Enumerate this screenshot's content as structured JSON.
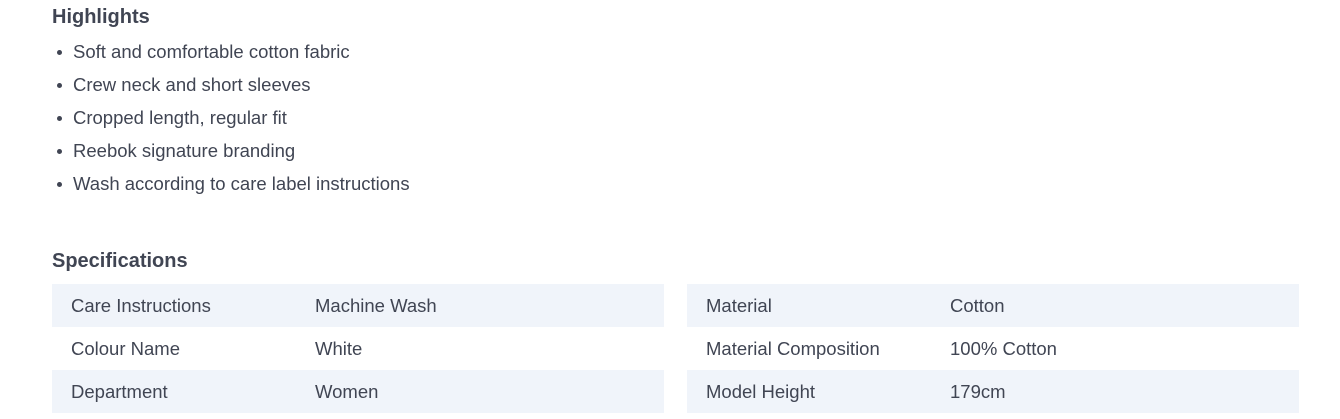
{
  "highlights": {
    "title": "Highlights",
    "items": [
      "Soft and comfortable cotton fabric",
      "Crew neck and short sleeves",
      "Cropped length, regular fit",
      "Reebok signature branding",
      "Wash according to care label instructions"
    ]
  },
  "specifications": {
    "title": "Specifications",
    "left": [
      {
        "key": "Care Instructions",
        "value": "Machine Wash"
      },
      {
        "key": "Colour Name",
        "value": "White"
      },
      {
        "key": "Department",
        "value": "Women"
      }
    ],
    "right": [
      {
        "key": "Material",
        "value": "Cotton"
      },
      {
        "key": "Material Composition",
        "value": "100% Cotton"
      },
      {
        "key": "Model Height",
        "value": "179cm"
      }
    ]
  },
  "colors": {
    "text": "#404553",
    "row_shade": "#f0f4fa",
    "background": "#ffffff"
  }
}
